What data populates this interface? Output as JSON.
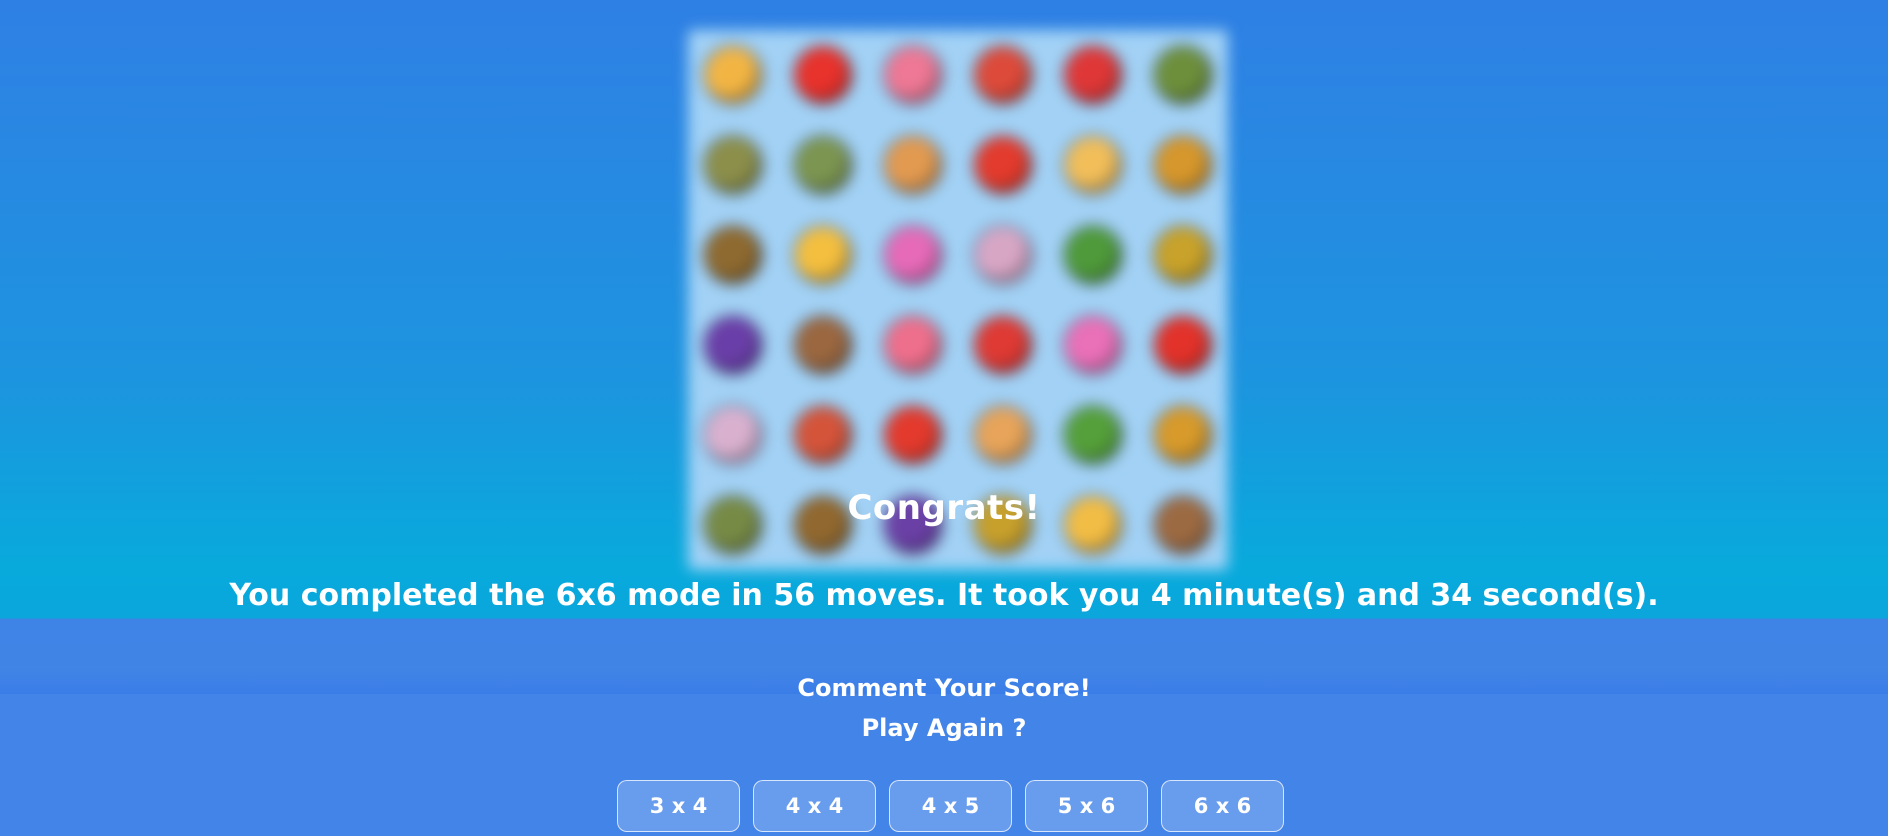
{
  "board": {
    "cells": [
      {
        "icon": "orange-icon",
        "color": "#f2b544"
      },
      {
        "icon": "tomato-icon",
        "color": "#e8322c"
      },
      {
        "icon": "mushroom-icon",
        "color": "#ee7895"
      },
      {
        "icon": "watermelon-icon",
        "color": "#dd4a3a"
      },
      {
        "icon": "watermelon-slice-icon",
        "color": "#df3737"
      },
      {
        "icon": "broccoli-icon",
        "color": "#6d8f3b"
      },
      {
        "icon": "broccoli-icon",
        "color": "#8c8f4a"
      },
      {
        "icon": "broccoli-icon",
        "color": "#7c9550"
      },
      {
        "icon": "carrot-icon",
        "color": "#e29a50"
      },
      {
        "icon": "tomato-icon",
        "color": "#e33b2d"
      },
      {
        "icon": "orange-icon",
        "color": "#f1be5a"
      },
      {
        "icon": "burger-icon",
        "color": "#d6972c"
      },
      {
        "icon": "burger-icon",
        "color": "#8e6a30"
      },
      {
        "icon": "orange-icon",
        "color": "#f4bf3f"
      },
      {
        "icon": "flower-icon",
        "color": "#e66ab8"
      },
      {
        "icon": "onion-icon",
        "color": "#d8a6c5"
      },
      {
        "icon": "pepper-icon",
        "color": "#4f9a3a"
      },
      {
        "icon": "pineapple-icon",
        "color": "#c8a22a"
      },
      {
        "icon": "eggplant-icon",
        "color": "#6a3ea8"
      },
      {
        "icon": "cookie-icon",
        "color": "#9a6740"
      },
      {
        "icon": "mushroom-icon",
        "color": "#ee6f8c"
      },
      {
        "icon": "watermelon-slice-icon",
        "color": "#df3a34"
      },
      {
        "icon": "flower-icon",
        "color": "#ea70b8"
      },
      {
        "icon": "tomato-icon",
        "color": "#e2322a"
      },
      {
        "icon": "onion-icon",
        "color": "#d9b1cf"
      },
      {
        "icon": "watermelon-icon",
        "color": "#d4543a"
      },
      {
        "icon": "tomato-icon",
        "color": "#e33a2d"
      },
      {
        "icon": "carrot-icon",
        "color": "#e7a45a"
      },
      {
        "icon": "pepper-icon",
        "color": "#55a03a"
      },
      {
        "icon": "burger-icon",
        "color": "#d79a2b"
      },
      {
        "icon": "broccoli-icon",
        "color": "#778a45"
      },
      {
        "icon": "burger-icon",
        "color": "#91682f"
      },
      {
        "icon": "eggplant-icon",
        "color": "#6b40a6"
      },
      {
        "icon": "pineapple-icon",
        "color": "#c7a02c"
      },
      {
        "icon": "orange-icon",
        "color": "#f2bd45"
      },
      {
        "icon": "cookie-icon",
        "color": "#9c6a42"
      }
    ]
  },
  "result": {
    "title": "Congrats!",
    "summary": "You completed the 6x6 mode in 56 moves. It took you 4 minute(s) and 34 second(s)."
  },
  "footer": {
    "comment": "Comment Your Score!",
    "play_again": "Play Again ?",
    "modes": [
      "3 x 4",
      "4 x 4",
      "4 x 5",
      "5 x 6",
      "6 x 6"
    ]
  },
  "colors": {
    "background_top": "#2f80e4",
    "background_mid": "#08aadc",
    "footer": "#4384e8",
    "text": "#ffffff"
  }
}
